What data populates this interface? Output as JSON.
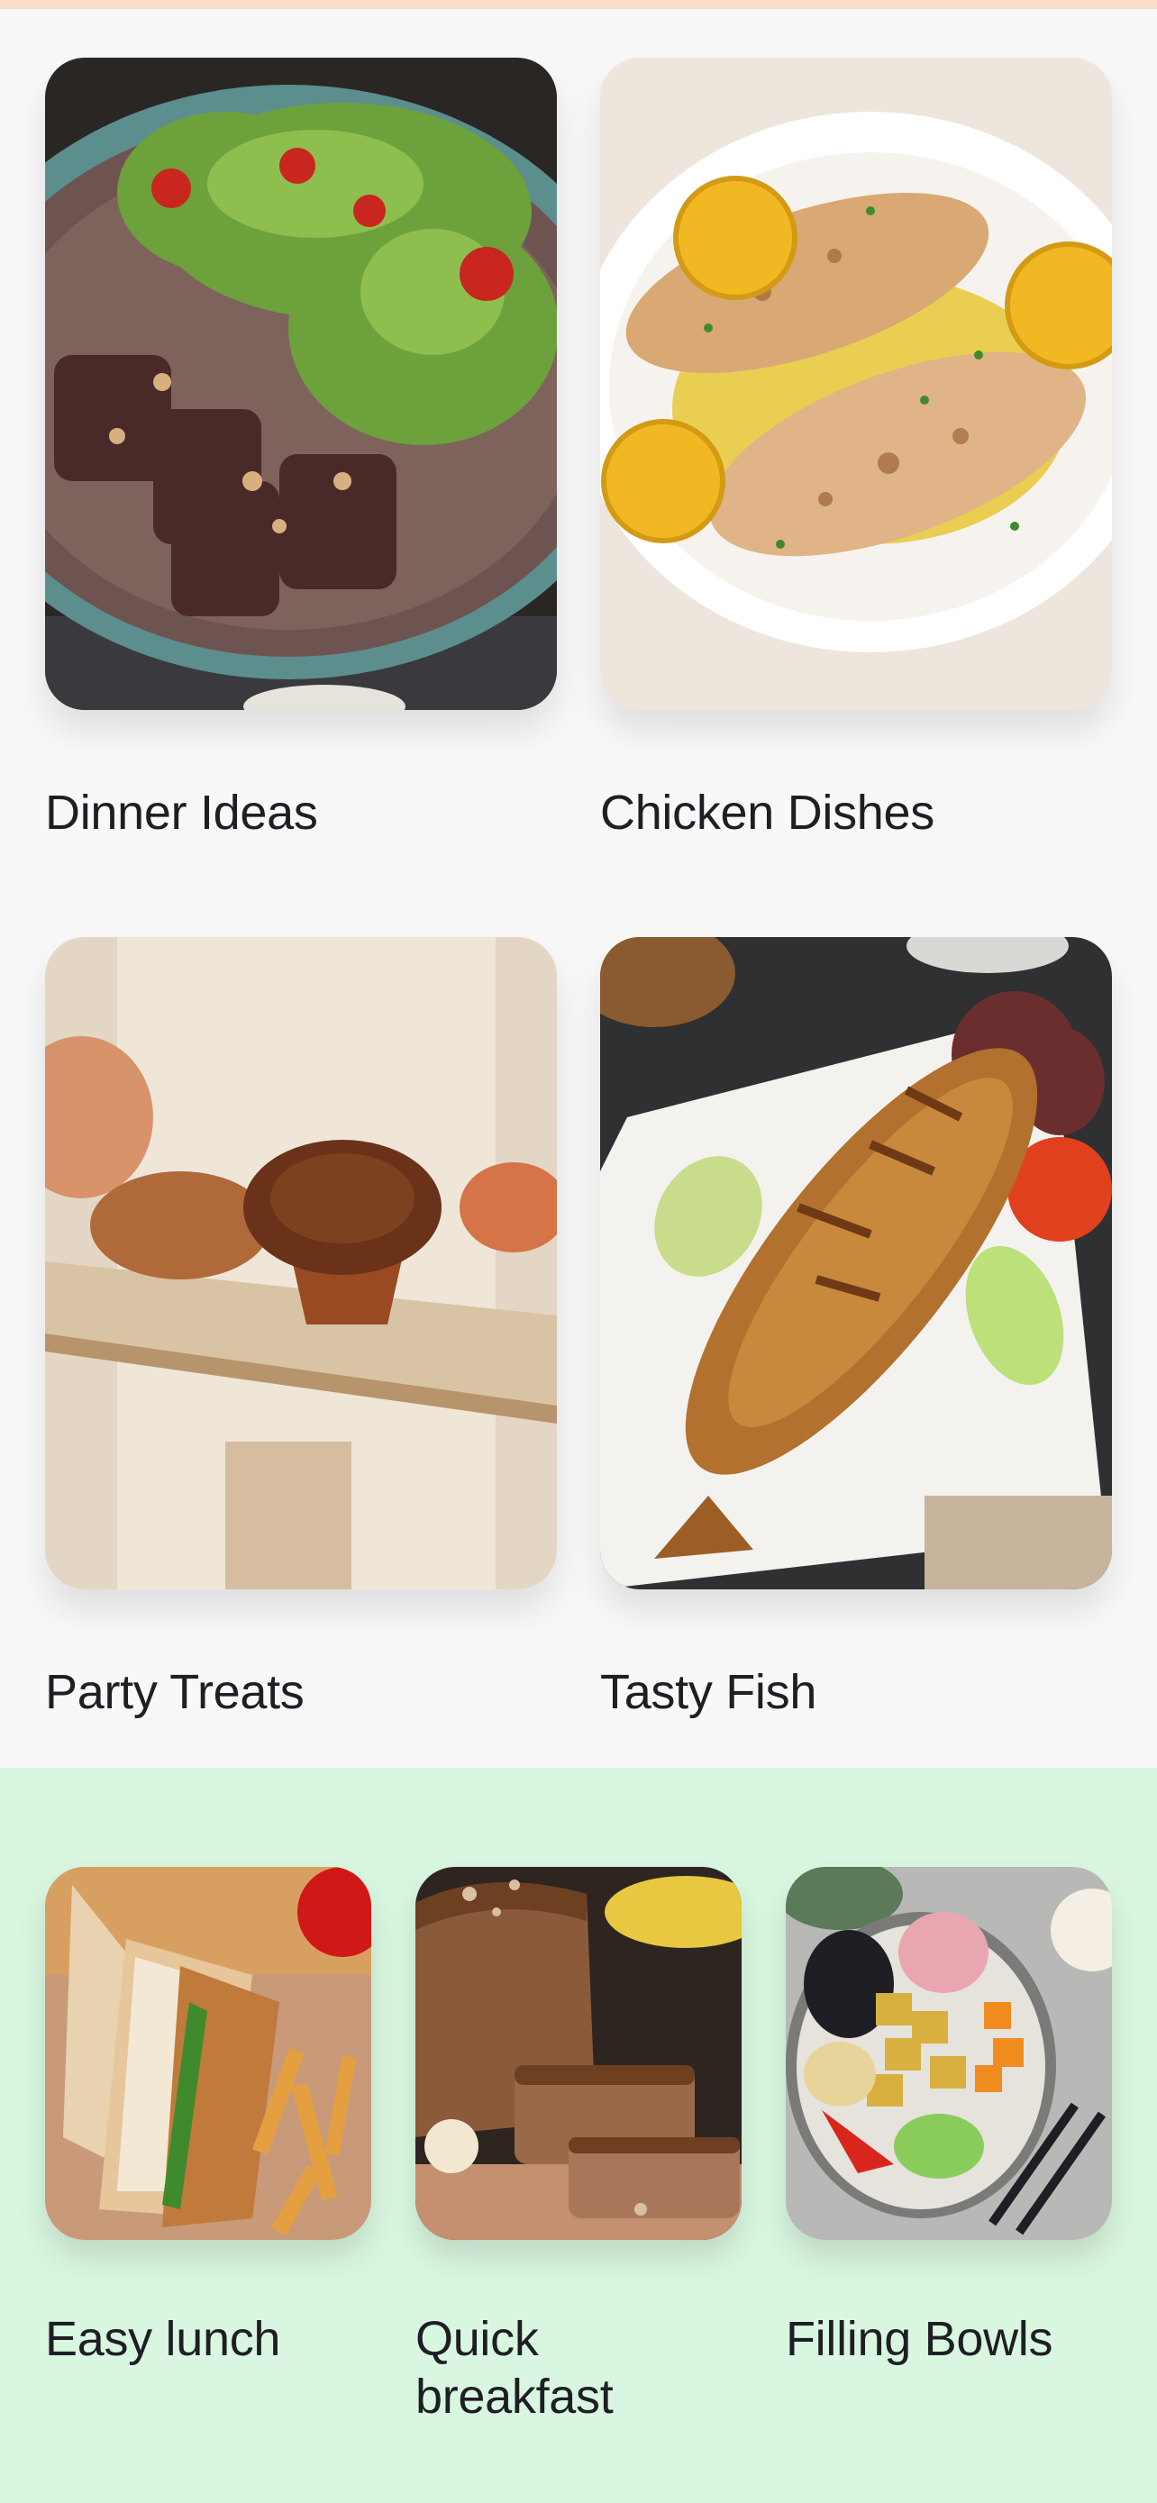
{
  "collections": {
    "top_grid": [
      {
        "title": "Dinner Ideas",
        "image": "steak-salad-plate"
      },
      {
        "title": "Chicken Dishes",
        "image": "grilled-chicken-lemon"
      },
      {
        "title": "Party Treats",
        "image": "muffin-pastry-board"
      },
      {
        "title": "Tasty Fish",
        "image": "fried-fish-platter"
      }
    ],
    "bottom_row": [
      {
        "title": "Easy lunch",
        "image": "sandwich-fries"
      },
      {
        "title": "Quick\nbreakfast",
        "image": "banana-bread"
      },
      {
        "title": "Filling Bowls",
        "image": "tofu-veggie-bowl"
      }
    ]
  },
  "colors": {
    "page_background": "#F8F8F8",
    "top_accent_strip": "#FCDCC4",
    "green_section": "#D9F7E0",
    "text": "#1E1E24"
  }
}
